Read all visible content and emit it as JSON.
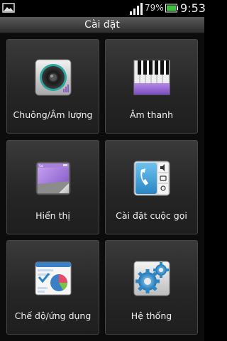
{
  "status_bar": {
    "battery_percent": "79%",
    "time": "9:53",
    "signal_level": 4,
    "battery_level": 0.79
  },
  "title": "Cài đặt",
  "tiles": [
    {
      "label": "Chuông/Âm lượng",
      "icon": "speaker-icon"
    },
    {
      "label": "Âm thanh",
      "icon": "piano-keys-icon"
    },
    {
      "label": "Hiển thị",
      "icon": "display-icon"
    },
    {
      "label": "Cài đặt cuộc gọi",
      "icon": "phone-call-icon"
    },
    {
      "label": "Chế độ/ứng dụng",
      "icon": "chart-icon"
    },
    {
      "label": "Hệ thống",
      "icon": "gears-icon"
    }
  ],
  "colors": {
    "background": "#0c0c0c",
    "tile": "#2c2c2c",
    "tile_border": "#474747",
    "battery_green": "#3fbf3f",
    "accent_purple": "#9b6bd6"
  }
}
